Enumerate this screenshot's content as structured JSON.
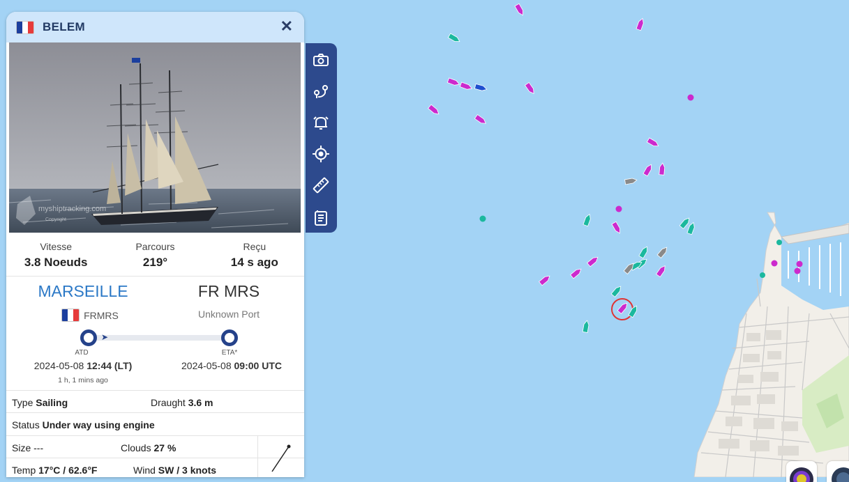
{
  "vessel": {
    "name": "BELEM",
    "flag": "france-flag",
    "photo_watermark": "myshiptracking.com",
    "photo_credit": "Copyright"
  },
  "stats": [
    {
      "label": "Vitesse",
      "value": "3.8 Noeuds"
    },
    {
      "label": "Parcours",
      "value": "219°"
    },
    {
      "label": "Reçu",
      "value": "14 s ago"
    }
  ],
  "route": {
    "origin": {
      "name": "MARSEILLE",
      "code": "FRMRS",
      "flag": "france-flag"
    },
    "destination": {
      "name": "FR MRS",
      "port": "Unknown Port"
    },
    "atd_label": "ATD",
    "eta_label": "ETA*",
    "atd_date": "2024-05-08",
    "atd_time": "12:44 (LT)",
    "atd_ago": "1 h, 1 mins ago",
    "eta_date": "2024-05-08",
    "eta_time": "09:00 UTC"
  },
  "details": {
    "type_label": "Type",
    "type_value": "Sailing",
    "draught_label": "Draught",
    "draught_value": "3.6 m",
    "status_label": "Status",
    "status_value": "Under way using engine",
    "size_label": "Size",
    "size_value": "---",
    "clouds_label": "Clouds",
    "clouds_value": "27 %",
    "temp_label": "Temp",
    "temp_value": "17°C / 62.6°F",
    "wind_label": "Wind",
    "wind_value": "SW / 3 knots"
  },
  "toolbar": [
    "camera-icon",
    "route-pins-icon",
    "alarm-bell-icon",
    "locate-target-icon",
    "ruler-icon",
    "document-icon"
  ],
  "colors": {
    "sea": "#a3d3f5",
    "header": "#cfe6fb",
    "toolbar": "#2d4a8d",
    "origin_link": "#2b78c6",
    "vessel_passenger": "#cc2acd",
    "vessel_cargo": "#1bb89e",
    "vessel_other": "#8a8a8a",
    "vessel_tanker": "#1f4fcf",
    "selected_ring": "#e03434"
  }
}
